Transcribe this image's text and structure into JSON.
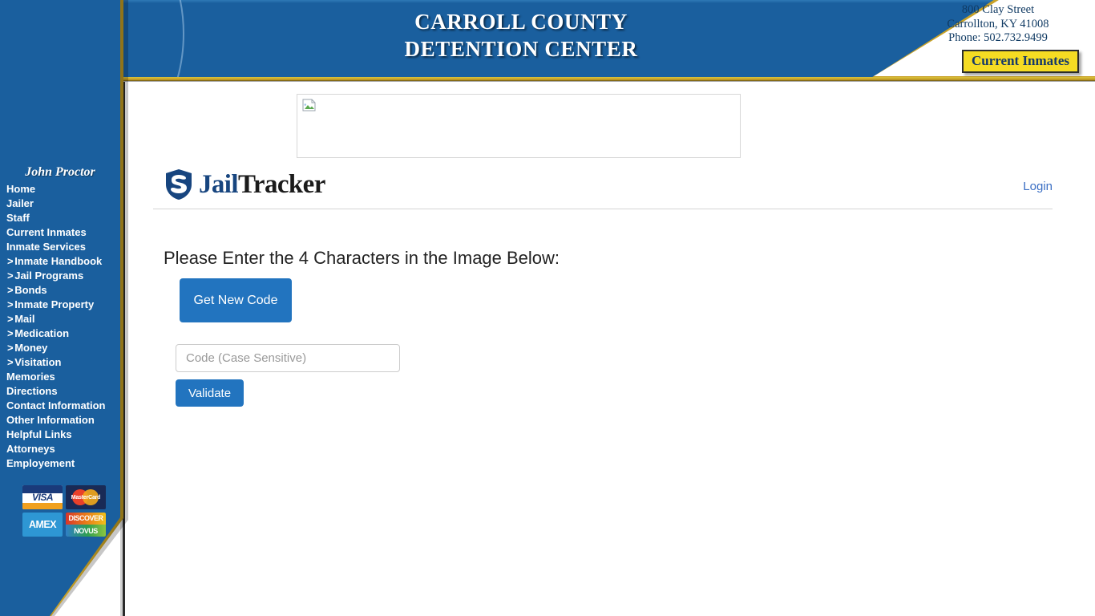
{
  "header": {
    "title_line1": "CARROLL COUNTY",
    "title_line2": "DETENTION CENTER",
    "address_line1": "800 Clay Street",
    "address_line2": "Carrollton, KY 41008",
    "address_line3": "Phone: 502.732.9499",
    "current_inmates_button": "Current Inmates",
    "jailer_photo_alt": "jailer-portrait",
    "colors": {
      "header_blue": "#1a5f9e",
      "gold": "#c9a227",
      "button_yellow": "#f5dc23"
    }
  },
  "sidebar": {
    "jailer_name": "John Proctor",
    "items": [
      {
        "label": "Home",
        "sub": false
      },
      {
        "label": "Jailer",
        "sub": false
      },
      {
        "label": "Staff",
        "sub": false
      },
      {
        "label": "Current Inmates",
        "sub": false
      },
      {
        "label": "Inmate Services",
        "sub": false
      },
      {
        "label": "Inmate Handbook",
        "sub": true
      },
      {
        "label": "Jail Programs",
        "sub": true
      },
      {
        "label": "Bonds",
        "sub": true
      },
      {
        "label": "Inmate Property",
        "sub": true
      },
      {
        "label": "Mail",
        "sub": true
      },
      {
        "label": "Medication",
        "sub": true
      },
      {
        "label": "Money",
        "sub": true
      },
      {
        "label": "Visitation",
        "sub": true
      },
      {
        "label": "Memories",
        "sub": false
      },
      {
        "label": "Directions",
        "sub": false
      },
      {
        "label": "Contact Information",
        "sub": false
      },
      {
        "label": "Other Information",
        "sub": false
      },
      {
        "label": "Helpful Links",
        "sub": false
      },
      {
        "label": "Attorneys",
        "sub": false
      },
      {
        "label": "Employement",
        "sub": false
      }
    ],
    "payment_cards": [
      {
        "name": "visa-card-logo",
        "text": "VISA"
      },
      {
        "name": "mastercard-card-logo",
        "text": "MasterCard"
      },
      {
        "name": "amex-card-logo",
        "text": "AMEX"
      },
      {
        "name": "discover-card-logo",
        "text_top": "DISCOVER",
        "text_bottom": "NOVUS"
      }
    ]
  },
  "main": {
    "banner_image_state": "broken-image-placeholder",
    "brand": {
      "icon": "shield-check-icon",
      "word_first": "Jail",
      "word_second": "Tracker"
    },
    "login_label": "Login",
    "prompt": "Please Enter the 4 Characters in the Image Below:",
    "get_new_code_label": "Get New Code",
    "code_input_value": "",
    "code_input_placeholder": "Code (Case Sensitive)",
    "validate_label": "Validate"
  }
}
